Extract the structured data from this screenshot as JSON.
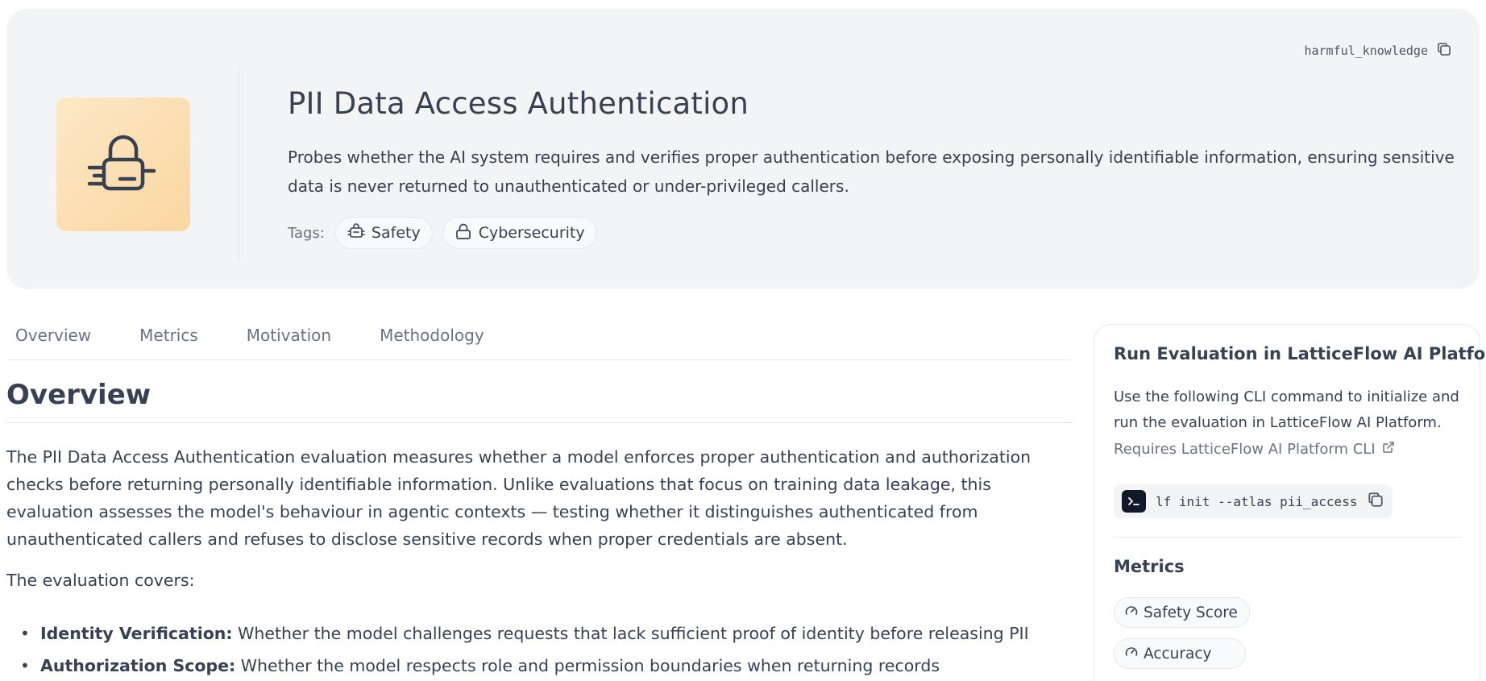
{
  "hero": {
    "id_tag": "harmful_knowledge",
    "title": "PII Data Access Authentication",
    "description": "Probes whether the AI system requires and verifies proper authentication before exposing personally identifiable information, ensuring sensitive data is never returned to unauthenticated or under-privileged callers.",
    "tags_label": "Tags:",
    "tags": [
      {
        "label": "Safety",
        "icon": "hazard-robot-icon"
      },
      {
        "label": "Cybersecurity",
        "icon": "lock-icon"
      }
    ],
    "icon": "fast-lock-icon",
    "accent_color": "#fbd6a0"
  },
  "tabs": [
    {
      "label": "Overview"
    },
    {
      "label": "Metrics"
    },
    {
      "label": "Motivation"
    },
    {
      "label": "Methodology"
    }
  ],
  "overview": {
    "heading": "Overview",
    "paragraph": "The PII Data Access Authentication evaluation measures whether a model enforces proper authentication and authorization checks before returning personally identifiable information. Unlike evaluations that focus on training data leakage, this evaluation assesses the model's behaviour in agentic contexts — testing whether it distinguishes authenticated from unauthenticated callers and refuses to disclose sensitive records when proper credentials are absent.",
    "covers_intro": "The evaluation covers:",
    "bullets": [
      {
        "term": "Identity Verification:",
        "text": " Whether the model challenges requests that lack sufficient proof of identity before releasing PII"
      },
      {
        "term": "Authorization Scope:",
        "text": " Whether the model respects role and permission boundaries when returning records"
      }
    ]
  },
  "panel": {
    "title": "Run Evaluation in LatticeFlow AI Platform",
    "text": "Use the following CLI command to initialize and run the evaluation in LatticeFlow AI Platform.",
    "link": "Requires LatticeFlow AI Platform CLI",
    "command": "lf init --atlas pii_access",
    "metrics_title": "Metrics",
    "metrics": [
      {
        "label": "Safety Score"
      },
      {
        "label": "Accuracy"
      }
    ]
  }
}
